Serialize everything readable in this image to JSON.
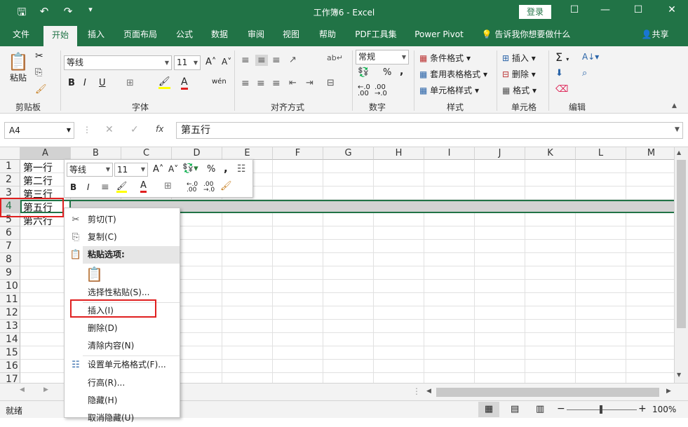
{
  "window": {
    "title": "工作簿6 - Excel",
    "login_label": "登录"
  },
  "tabs": [
    "文件",
    "开始",
    "插入",
    "页面布局",
    "公式",
    "数据",
    "审阅",
    "视图",
    "帮助",
    "PDF工具集",
    "Power Pivot"
  ],
  "tell_me": "告诉我你想要做什么",
  "share_label": "共享",
  "ribbon": {
    "groups": [
      "剪贴板",
      "字体",
      "对齐方式",
      "数字",
      "样式",
      "单元格",
      "编辑"
    ],
    "paste_label": "粘贴",
    "font_name": "等线",
    "font_size": "11",
    "number_format": "常规",
    "styles": [
      "条件格式",
      "套用表格格式",
      "单元格样式"
    ],
    "cells": [
      "插入",
      "删除",
      "格式"
    ]
  },
  "formula_bar": {
    "name_box": "A4",
    "fx_label": "fx",
    "value": "第五行"
  },
  "columns": [
    "A",
    "B",
    "C",
    "D",
    "E",
    "F",
    "G",
    "H",
    "I",
    "J",
    "K",
    "L",
    "M"
  ],
  "rows": [
    "1",
    "2",
    "3",
    "4",
    "5",
    "6",
    "7",
    "8",
    "9",
    "10",
    "11",
    "12",
    "13",
    "14",
    "15",
    "16",
    "17"
  ],
  "cells": {
    "A1": "第一行",
    "A2": "第二行",
    "A3": "第三行",
    "A4": "第五行",
    "A5": "第六行"
  },
  "mini_toolbar": {
    "font_name": "等线",
    "font_size": "11"
  },
  "context_menu": {
    "items": [
      "剪切(T)",
      "复制(C)",
      "粘贴选项:",
      "",
      "选择性粘贴(S)...",
      "插入(I)",
      "删除(D)",
      "清除内容(N)",
      "设置单元格格式(F)...",
      "行高(R)...",
      "隐藏(H)",
      "取消隐藏(U)"
    ]
  },
  "status": {
    "ready": "就绪",
    "zoom": "100%"
  },
  "colors": {
    "excel_green": "#217346",
    "highlight_red": "#e02020"
  }
}
